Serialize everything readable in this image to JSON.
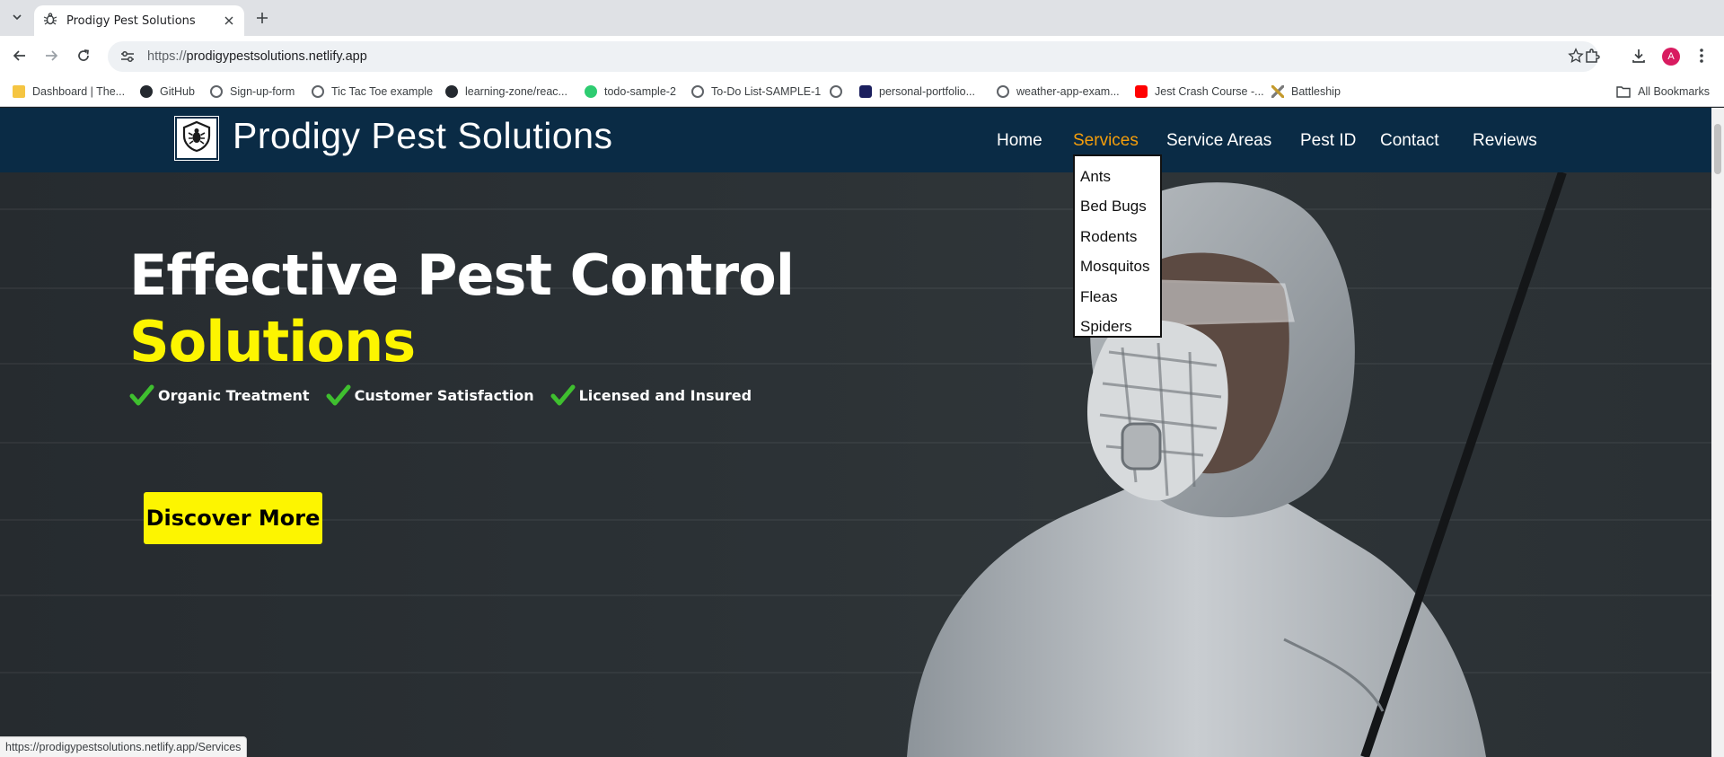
{
  "browser": {
    "tab_title": "Prodigy Pest Solutions",
    "url_protocol": "https://",
    "url_host": "prodigypestsolutions.netlify.app",
    "avatar_letter": "A",
    "status_url": "https://prodigypestsolutions.netlify.app/Services"
  },
  "bookmarks": {
    "items": [
      {
        "label": "Dashboard | The...",
        "icon": "trophy-icon"
      },
      {
        "label": "GitHub",
        "icon": "github-icon"
      },
      {
        "label": "Sign-up-form",
        "icon": "globe-icon"
      },
      {
        "label": "Tic Tac Toe example",
        "icon": "globe-icon"
      },
      {
        "label": "learning-zone/reac...",
        "icon": "github-icon"
      },
      {
        "label": "todo-sample-2",
        "icon": "check-circle-icon"
      },
      {
        "label": "To-Do List-SAMPLE-1",
        "icon": "globe-icon"
      },
      {
        "label": "",
        "icon": "globe-icon"
      },
      {
        "label": "personal-portfolio...",
        "icon": "angular-icon"
      },
      {
        "label": "weather-app-exam...",
        "icon": "globe-icon"
      },
      {
        "label": "Jest Crash Course -...",
        "icon": "youtube-icon"
      },
      {
        "label": "Battleship",
        "icon": "swords-icon"
      }
    ],
    "all_label": "All Bookmarks"
  },
  "site": {
    "brand": "Prodigy Pest Solutions",
    "nav": {
      "home": "Home",
      "services": "Services",
      "service_areas": "Service Areas",
      "pest_id": "Pest ID",
      "contact": "Contact",
      "reviews": "Reviews"
    },
    "services_dropdown": [
      "Ants",
      "Bed Bugs",
      "Rodents",
      "Mosquitos",
      "Fleas",
      "Spiders"
    ],
    "hero": {
      "headline_line1": "Effective Pest Control",
      "headline_line2": "Solutions",
      "features": [
        "Organic Treatment",
        "Customer Satisfaction",
        "Licensed and Insured"
      ],
      "cta": "Discover More"
    }
  },
  "colors": {
    "header_bg": "#0a2b45",
    "accent_yellow": "#fdf500",
    "nav_active": "#f59e0b",
    "check_green": "#3fbf2f"
  }
}
